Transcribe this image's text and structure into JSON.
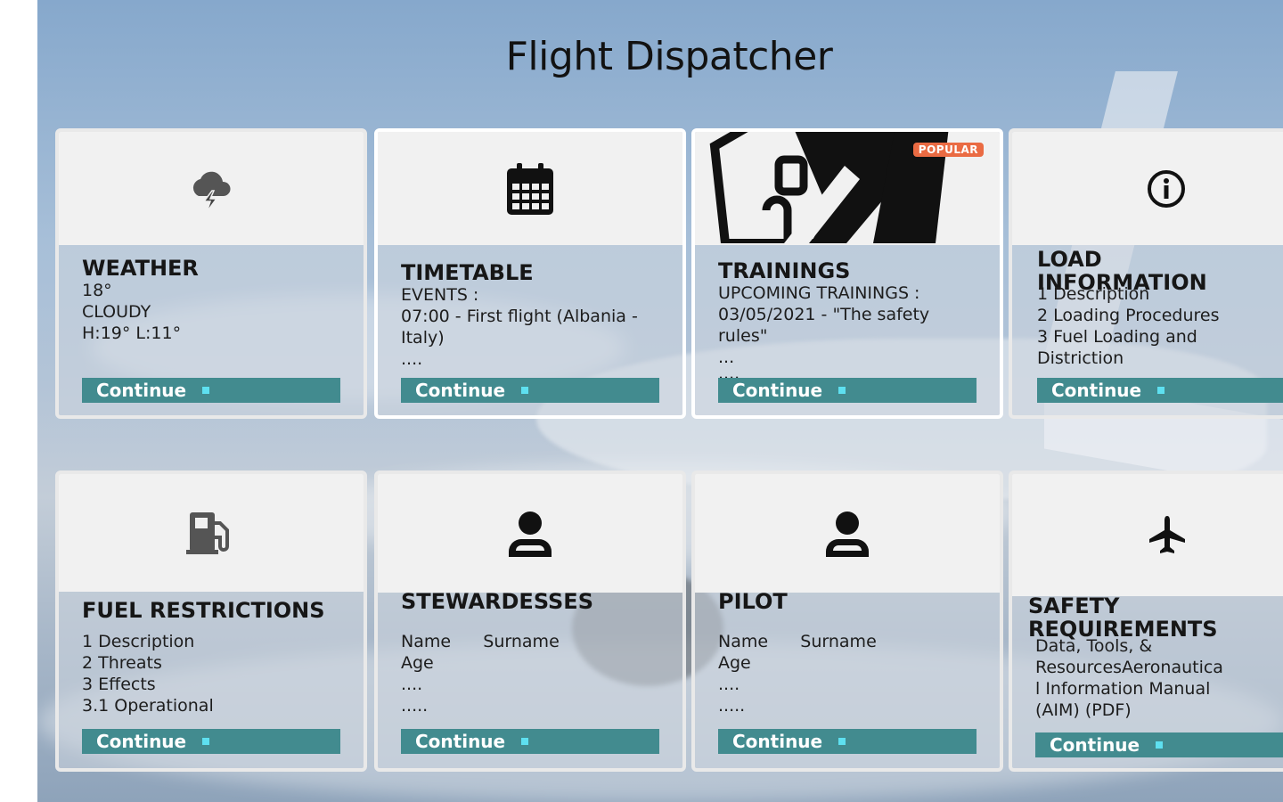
{
  "page": {
    "title": "Flight Dispatcher"
  },
  "continue_label": "Continue",
  "cards": [
    {
      "title": "WEATHER",
      "icon": "storm-cloud-icon",
      "lines": [
        "18°",
        "CLOUDY",
        "H:19° L:11°"
      ]
    },
    {
      "title": "TIMETABLE",
      "icon": "calendar-icon",
      "lines": [
        "EVENTS :",
        "07:00 - First flight (Albania -",
        "Italy)",
        "....",
        "...."
      ]
    },
    {
      "title": "TRAININGS",
      "icon": "training-graphic",
      "badge": "POPULAR",
      "lines": [
        "UPCOMING TRAININGS :",
        "03/05/2021 - \"The safety",
        "rules\"",
        "...",
        "...."
      ]
    },
    {
      "title": "LOAD INFORMATION",
      "icon": "info-icon",
      "lines": [
        "1 Description",
        "2 Loading Procedures",
        "3 Fuel Loading and",
        "Distriction"
      ]
    },
    {
      "title": "FUEL RESTRICTIONS",
      "icon": "fuel-pump-icon",
      "lines": [
        "1 Description",
        "2 Threats",
        "3 Effects",
        "3.1 Operational"
      ]
    },
    {
      "title": "STEWARDESSES",
      "icon": "person-icon",
      "lines": [
        "Name      Surname",
        "Age",
        "....",
        "....."
      ]
    },
    {
      "title": "PILOT",
      "icon": "person-icon",
      "lines": [
        "Name      Surname",
        "Age",
        "....",
        "....."
      ]
    },
    {
      "title": "SAFETY REQUIREMENTS",
      "icon": "airplane-icon",
      "lines": [
        "Data, Tools, &",
        "ResourcesAeronautica",
        "l Information Manual",
        "(AIM) (PDF)"
      ]
    }
  ],
  "colors": {
    "continue_bg": "#428b8f",
    "badge": "#ea6b43",
    "header_bg": "#f1f1f1"
  }
}
